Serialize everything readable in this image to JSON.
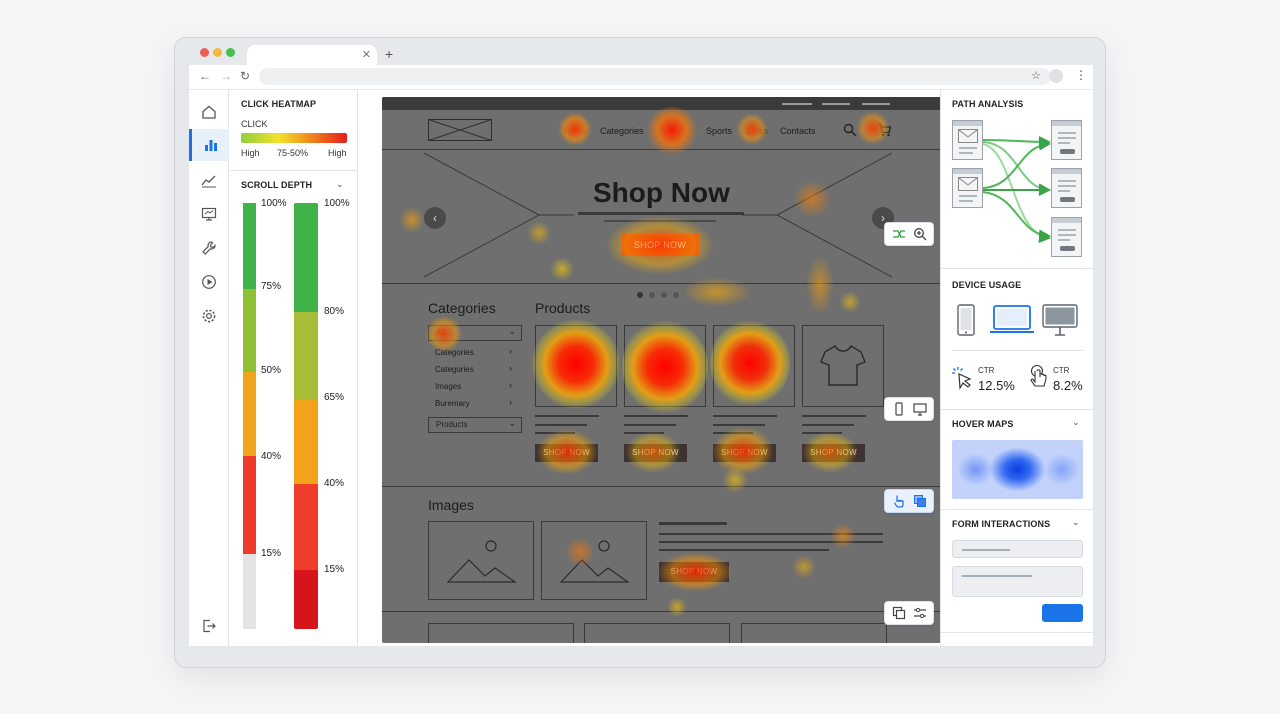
{
  "left_panel": {
    "title": "CLICK HEATMAP",
    "click_label": "CLICK",
    "legend": [
      "High",
      "75-50%",
      "High"
    ],
    "scroll_title": "SCROLL DEPTH",
    "scroll_labels_a": [
      "100%",
      "75%",
      "50%",
      "40%",
      "15%"
    ],
    "scroll_labels_b": [
      "100%",
      "80%",
      "65%",
      "40%",
      "15%"
    ]
  },
  "site": {
    "nav": [
      "Home",
      "Categories",
      "Sports",
      "Links",
      "Contacts"
    ],
    "hero_title": "Shop Now",
    "hero_button": "SHOP NOW",
    "categories_title": "Categories",
    "select_all": "All",
    "category_items": [
      "Categories",
      "Categories",
      "Images",
      "Buremary"
    ],
    "products_select": "Products",
    "products_title": "Products",
    "product_button": "SHOP NOW",
    "images_title": "Images",
    "images_button": "SHOP NOW"
  },
  "right_panel": {
    "path_title": "PATH ANALYSIS",
    "device_title": "DEVICE USAGE",
    "ctr_label": "CTR",
    "ctr_values": [
      "12.5%",
      "8.2%"
    ],
    "hover_title": "HOVER MAPS",
    "form_title": "FORM INTERACTIONS"
  },
  "icons": {
    "rail": [
      "home-icon",
      "bar-chart-icon",
      "line-chart-icon",
      "monitor-icon",
      "wrench-icon",
      "play-icon",
      "gear-icon",
      "logout-icon"
    ]
  },
  "colors": {
    "accent": "#1a73e8",
    "heat_hot": "#ff2a00",
    "heat_warm": "#ffd000"
  }
}
